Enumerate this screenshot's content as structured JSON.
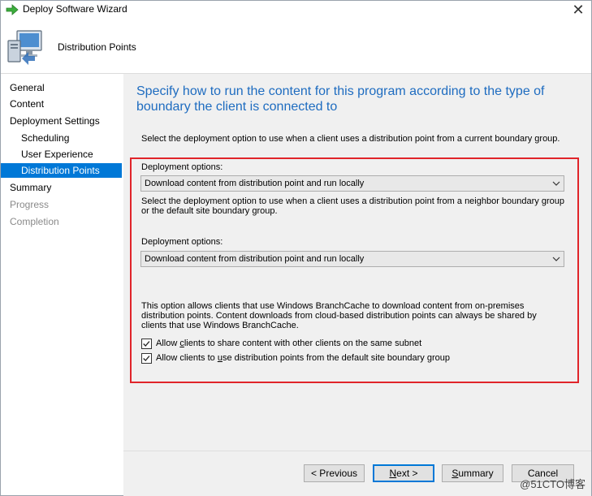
{
  "window": {
    "title": "Deploy Software Wizard",
    "close_glyph": "✕"
  },
  "header": {
    "page_title": "Distribution Points"
  },
  "sidebar": {
    "items": [
      {
        "label": "General",
        "state": "normal"
      },
      {
        "label": "Content",
        "state": "normal"
      },
      {
        "label": "Deployment Settings",
        "state": "normal"
      },
      {
        "label": "Scheduling",
        "state": "normal"
      },
      {
        "label": "User Experience",
        "state": "normal"
      },
      {
        "label": "Distribution Points",
        "state": "active"
      },
      {
        "label": "Summary",
        "state": "normal"
      },
      {
        "label": "Progress",
        "state": "disabled"
      },
      {
        "label": "Completion",
        "state": "disabled"
      }
    ]
  },
  "main": {
    "heading": "Specify how to run the content for this program according to the type of boundary the client is connected to",
    "current_boundary_desc": "Select the deployment option to use when a client uses a distribution point from a current boundary group.",
    "deployment_options_1": {
      "label": "Deployment options:",
      "value": "Download content from distribution point and run locally"
    },
    "neighbor_boundary_desc": "Select the deployment option to use when a client uses a distribution point from a neighbor boundary group or the default site boundary group.",
    "deployment_options_2": {
      "label": "Deployment options:",
      "value": "Download content from distribution point and run locally"
    },
    "branchcache_desc": "This option allows clients that use Windows BranchCache to download content from on-premises distribution points. Content downloads from cloud-based distribution points can always be shared by clients that use Windows BranchCache.",
    "checkboxes": [
      {
        "label_pre": "Allow ",
        "label_key": "c",
        "label_post": "lients to share content with other clients on the same subnet",
        "checked": true
      },
      {
        "label_pre": "Allow clients to ",
        "label_key": "u",
        "label_post": "se distribution points from the default site boundary group",
        "checked": true
      }
    ]
  },
  "buttons": {
    "previous_key": "< P",
    "previous_rest": "revious",
    "next_key": "N",
    "next_rest": "ext >",
    "summary_key": "S",
    "summary_rest": "ummary",
    "cancel": "Cancel"
  },
  "watermark": "@51CTO博客",
  "colors": {
    "accent": "#0078d7",
    "heading": "#1e6cc0",
    "highlight_box": "#e0242a"
  },
  "icons": {
    "title": "green-arrow-icon",
    "header": "computer-install-icon",
    "dropdown": "chevron-down-icon",
    "checkbox": "checkmark-icon"
  }
}
